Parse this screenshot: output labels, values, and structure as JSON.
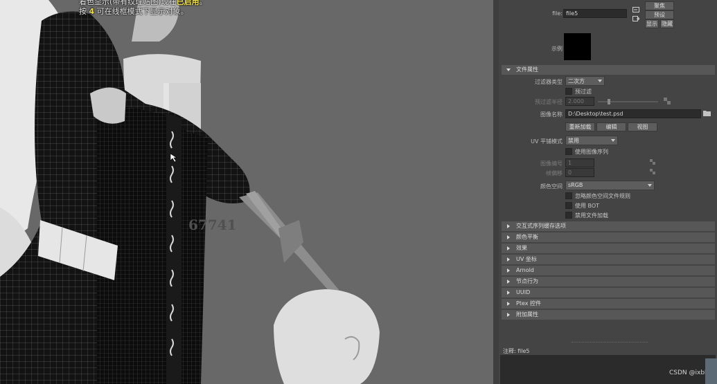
{
  "viewport": {
    "hud_line1_a": "着色显示(带有纹理贴图)现在",
    "hud_line1_b": "已启用",
    "hud_line1_c": "。",
    "hud_line2_a": "按 ",
    "hud_line2_b": "4",
    "hud_line2_c": " 可在线框模式下显示对象。",
    "watermark": "67741"
  },
  "file_header": {
    "file_label": "file:",
    "file_value": "file5",
    "focus_button": "聚焦",
    "preset_button": "预设",
    "show_button": "显示",
    "hide_button": "隐藏",
    "sample_label": "示例"
  },
  "file_attributes": {
    "section_label": "文件属性",
    "filter_type_label": "过滤器类型",
    "filter_type_value": "二次方",
    "prefilter_label": "预过滤",
    "prefilter_radius_label": "预过滤半径",
    "prefilter_radius_value": "2.000",
    "image_name_label": "图像名称",
    "image_name_value": "D:\\Desktop\\test.psd",
    "reload_button": "重新加载",
    "edit_button": "编辑",
    "view_button": "视图",
    "uv_tiling_label": "UV 平铺模式",
    "uv_tiling_value": "禁用",
    "use_sequence_label": "使用图像序列",
    "image_number_label": "图像编号",
    "image_number_value": "1",
    "frame_offset_label": "帧偏移",
    "frame_offset_value": "0",
    "color_space_label": "颜色空间",
    "color_space_value": "sRGB",
    "ignore_cs_label": "忽略颜色空间文件规则",
    "use_bot_label": "使用 BOT",
    "disable_load_label": "禁用文件加载"
  },
  "sections": [
    {
      "label": "交互式序列缓存选项"
    },
    {
      "label": "颜色平衡"
    },
    {
      "label": "效果"
    },
    {
      "label": "UV 坐标"
    },
    {
      "label": "Arnold"
    },
    {
      "label": "节点行为"
    },
    {
      "label": "UUID"
    },
    {
      "label": "Ptex 控件"
    },
    {
      "label": "附加属性"
    }
  ],
  "notes": {
    "label": "注释:",
    "value": "file5"
  },
  "credit": "CSDN @ixbb",
  "colors": {
    "viewport_bg": "#686868",
    "panel_bg": "#444444",
    "hud_highlight": "#f0e04a"
  }
}
